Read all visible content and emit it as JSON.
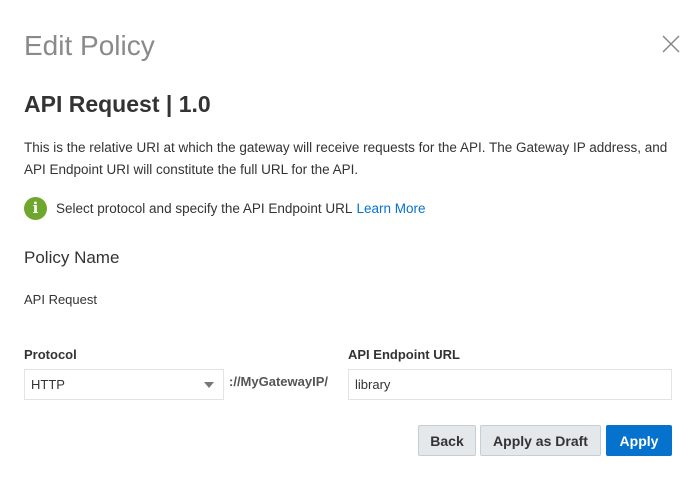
{
  "dialog": {
    "title": "Edit Policy",
    "close_icon": "close-icon"
  },
  "policy": {
    "subtitle": "API Request | 1.0",
    "description": "This is the relative URI at which the gateway will receive requests for the API. The Gateway IP address, and API Endpoint URI will constitute the full URL for the API.",
    "info_icon": "info-icon",
    "info_text": "Select protocol and specify the API Endpoint URL",
    "learn_more": "Learn More",
    "name_label": "Policy Name",
    "name_value": "API Request"
  },
  "form": {
    "protocol_label": "Protocol",
    "protocol_value": "HTTP",
    "gateway_text": "://MyGatewayIP/",
    "endpoint_label": "API Endpoint URL",
    "endpoint_value": "library"
  },
  "buttons": {
    "back": "Back",
    "apply_draft": "Apply as Draft",
    "apply": "Apply"
  },
  "colors": {
    "primary": "#0572ce",
    "info_green": "#6fa62d",
    "title_gray": "#8a8a8a"
  }
}
